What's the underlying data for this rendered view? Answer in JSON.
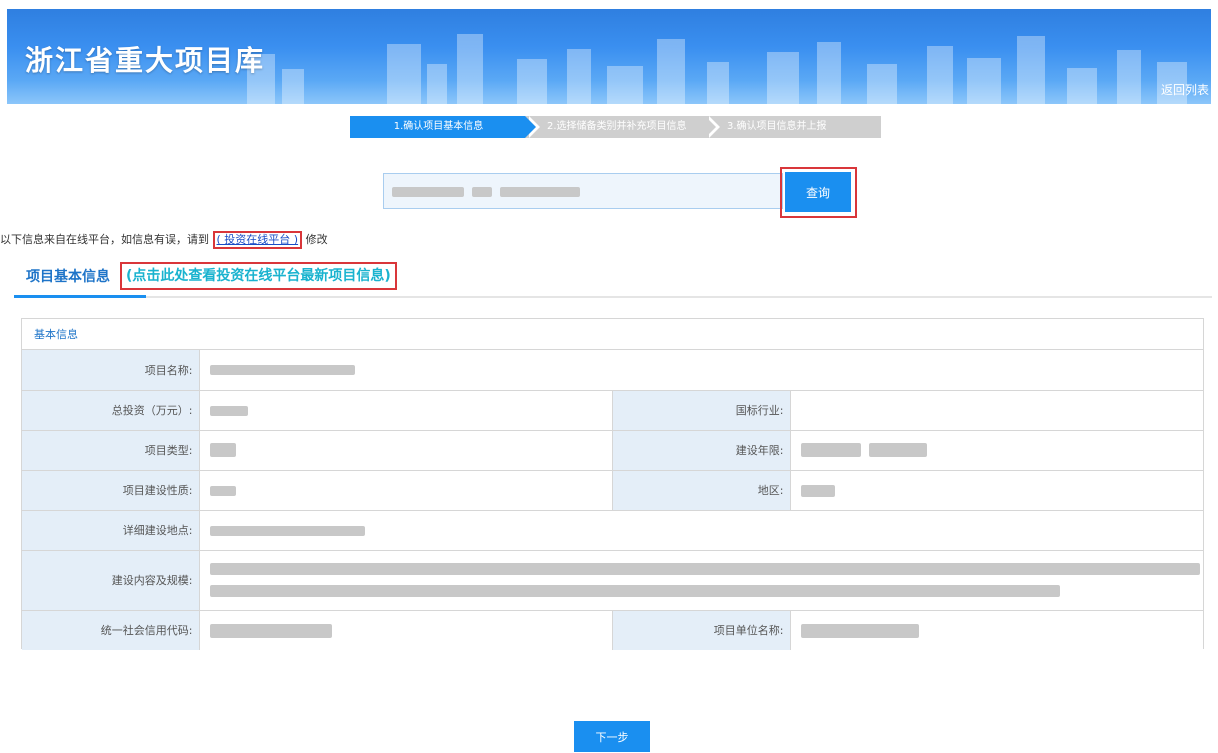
{
  "header": {
    "title": "浙江省重大项目库",
    "back_label": "返回列表"
  },
  "steps": [
    {
      "label": "1.确认项目基本信息",
      "active": true
    },
    {
      "label": "2.选择储备类别并补充项目信息",
      "active": false
    },
    {
      "label": "3.确认项目信息并上报",
      "active": false
    }
  ],
  "search": {
    "button_label": "查询"
  },
  "notice": {
    "prefix": "以下信息来自在线平台，如信息有误，请到",
    "link_label": "( 投资在线平台 )",
    "suffix": "修改"
  },
  "tab": {
    "label": "项目基本信息",
    "link_label": "(点击此处查看投资在线平台最新项目信息)"
  },
  "panel": {
    "title": "基本信息",
    "fields": {
      "project_name": "项目名称:",
      "total_investment": "总投资（万元）:",
      "industry": "国标行业:",
      "project_type": "项目类型:",
      "construction_period": "建设年限:",
      "construction_nature": "项目建设性质:",
      "region": "地区:",
      "address": "详细建设地点:",
      "content_scale": "建设内容及规模:",
      "credit_code": "统一社会信用代码:",
      "unit_name": "项目单位名称:"
    }
  },
  "footer": {
    "next_label": "下一步"
  },
  "colors": {
    "accent": "#1a8ff0",
    "highlight_frame": "#d9363a",
    "label_bg": "#e4eef8",
    "tab_link": "#19b3cf"
  }
}
